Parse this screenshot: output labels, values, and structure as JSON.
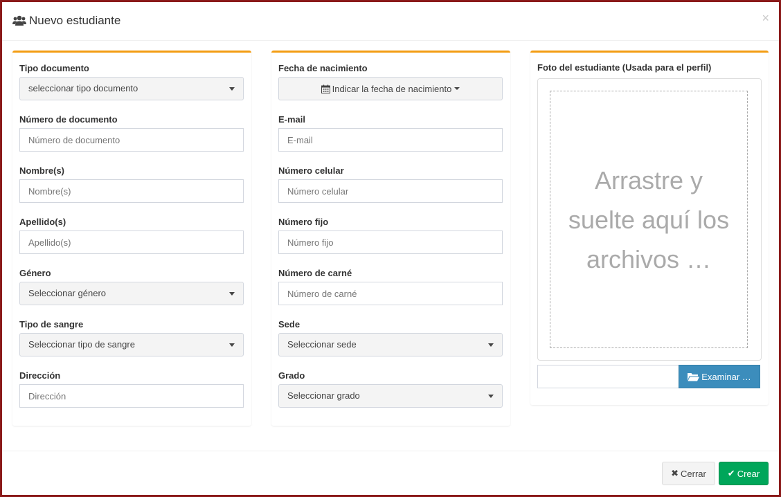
{
  "modal": {
    "title": "Nuevo estudiante",
    "close_symbol": "×",
    "title_icon": "users-icon"
  },
  "column1": {
    "tipo_documento": {
      "label": "Tipo documento",
      "value": "seleccionar tipo documento"
    },
    "numero_documento": {
      "label": "Número de documento",
      "placeholder": "Número de documento"
    },
    "nombres": {
      "label": "Nombre(s)",
      "placeholder": "Nombre(s)"
    },
    "apellidos": {
      "label": "Apellido(s)",
      "placeholder": "Apellido(s)"
    },
    "genero": {
      "label": "Género",
      "value": "Seleccionar género"
    },
    "tipo_sangre": {
      "label": "Tipo de sangre",
      "value": "Seleccionar tipo de sangre"
    },
    "direccion": {
      "label": "Dirección",
      "placeholder": "Dirección"
    }
  },
  "column2": {
    "fecha_nacimiento": {
      "label": "Fecha de nacimiento",
      "button": "Indicar la fecha de nacimiento"
    },
    "email": {
      "label": "E-mail",
      "placeholder": "E-mail"
    },
    "celular": {
      "label": "Número celular",
      "placeholder": "Número celular"
    },
    "fijo": {
      "label": "Número fijo",
      "placeholder": "Número fijo"
    },
    "carne": {
      "label": "Número de carné",
      "placeholder": "Número de carné"
    },
    "sede": {
      "label": "Sede",
      "value": "Seleccionar sede"
    },
    "grado": {
      "label": "Grado",
      "value": "Seleccionar grado"
    }
  },
  "column3": {
    "photo_label": "Foto del estudiante (Usada para el perfil)",
    "drop_text": "Arrastre y suelte aquí los archivos …",
    "browse_button": "Examinar …"
  },
  "footer": {
    "close_button": "Cerrar",
    "create_button": "Crear"
  },
  "colors": {
    "box_accent": "#f39c12",
    "primary": "#3c8dbc",
    "success": "#00a65a",
    "backdrop": "#8b1a1a"
  }
}
